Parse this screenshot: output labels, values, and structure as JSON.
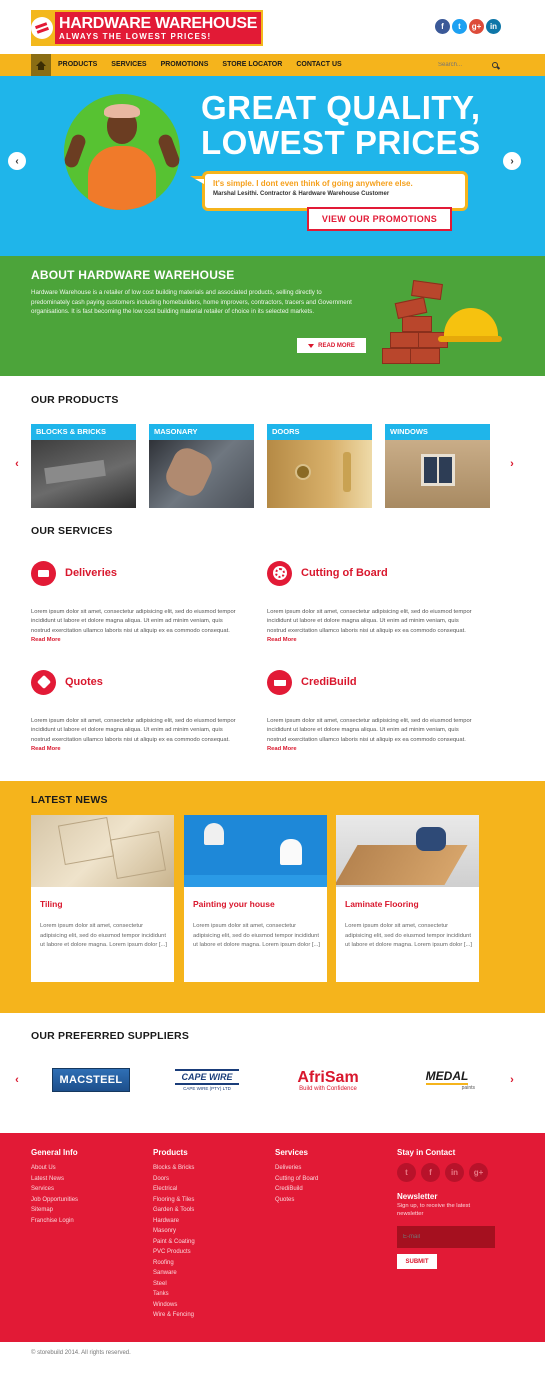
{
  "header": {
    "logo_title": "HARDWARE WAREHOUSE",
    "logo_tagline": "ALWAYS THE LOWEST PRICES!",
    "social": [
      {
        "icon": "facebook-icon",
        "glyph": "f",
        "color": "#3b5998"
      },
      {
        "icon": "twitter-icon",
        "glyph": "t",
        "color": "#1da1f2"
      },
      {
        "icon": "google-plus-icon",
        "glyph": "g+",
        "color": "#dd4b39"
      },
      {
        "icon": "linkedin-icon",
        "glyph": "in",
        "color": "#0e76a8"
      }
    ]
  },
  "nav": {
    "items": [
      "PRODUCTS",
      "SERVICES",
      "PROMOTIONS",
      "STORE LOCATOR",
      "CONTACT US"
    ],
    "search_placeholder": "Search..."
  },
  "hero": {
    "title_line1": "GREAT QUALITY,",
    "title_line2": "LOWEST PRICES",
    "quote": "It's simple. I dont even think of going anywhere else.",
    "author": "Marshal Lesithi. Contractor & Hardware Warehouse Customer",
    "cta": "VIEW OUR PROMOTIONS",
    "prev": "‹",
    "next": "›"
  },
  "about": {
    "title": "ABOUT HARDWARE WAREHOUSE",
    "text": "Hardware Warehouse is a retailer of low cost building materials and associated products, selling directly to predominately cash paying customers including homebuilders, home improvers, contractors, tracers and Government organisations. It is fast becoming the low cost building material retailer of choice in its selected markets.",
    "read_more": "READ MORE"
  },
  "products": {
    "title": "OUR PRODUCTS",
    "items": [
      "BLOCKS & BRICKS",
      "MASONARY",
      "DOORS",
      "WINDOWS"
    ],
    "prev": "‹",
    "next": "›"
  },
  "services": {
    "title": "OUR SERVICES",
    "items": [
      {
        "name": "Deliveries",
        "icon": "truck-icon",
        "text": "Lorem ipsum dolor sit amet, consectetur adipisicing elit, sed do eiusmod tempor incididunt ut labore et dolore magna aliqua. Ut enim ad minim veniam, quis nostrud exercitation ullamco laboris nisi ut aliquip ex ea commodo consequat.",
        "read_more": "Read More"
      },
      {
        "name": "Cutting of Board",
        "icon": "saw-blade-icon",
        "text": "Lorem ipsum dolor sit amet, consectetur adipisicing elit, sed do eiusmod tempor incididunt ut labore et dolore magna aliqua. Ut enim ad minim veniam, quis nostrud exercitation ullamco laboris nisi ut aliquip ex ea commodo consequat.",
        "read_more": "Read More"
      },
      {
        "name": "Quotes",
        "icon": "price-tag-icon",
        "text": "Lorem ipsum dolor sit amet, consectetur adipisicing elit, sed do eiusmod tempor incididunt ut labore et dolore magna aliqua. Ut enim ad minim veniam, quis nostrud exercitation ullamco laboris nisi ut aliquip ex ea commodo consequat.",
        "read_more": "Read More"
      },
      {
        "name": "CrediBuild",
        "icon": "credit-card-icon",
        "text": "Lorem ipsum dolor sit amet, consectetur adipisicing elit, sed do eiusmod tempor incididunt ut labore et dolore magna aliqua. Ut enim ad minim veniam, quis nostrud exercitation ullamco laboris nisi ut aliquip ex ea commodo consequat.",
        "read_more": "Read More"
      }
    ]
  },
  "news": {
    "title": "LATEST NEWS",
    "items": [
      {
        "heading": "Tiling",
        "text": "Lorem ipsum dolor sit amet, consectetur adipisicing elit, sed do eiusmod tempor incididunt ut labore et dolore magna. Lorem ipsum dolor [...]"
      },
      {
        "heading": "Painting your house",
        "text": "Lorem ipsum dolor sit amet, consectetur adipisicing elit, sed do eiusmod tempor incididunt ut labore et dolore magna. Lorem ipsum dolor [...]"
      },
      {
        "heading": "Laminate Flooring",
        "text": "Lorem ipsum dolor sit amet, consectetur adipisicing elit, sed do eiusmod tempor incididunt ut labore et dolore magna. Lorem ipsum dolor [...]"
      }
    ]
  },
  "suppliers": {
    "title": "OUR PREFERRED SUPPLIERS",
    "logos": [
      {
        "name": "MACSTEEL"
      },
      {
        "name": "CAPE WIRE",
        "sub": "CAPE WIRE (PTY) LTD"
      },
      {
        "name": "AfriSam",
        "sub": "Build with Confidence"
      },
      {
        "name": "MEDAL",
        "sub": "paints"
      }
    ],
    "prev": "‹",
    "next": "›"
  },
  "footer": {
    "general": {
      "title": "General Info",
      "links": [
        "About Us",
        "Latest News",
        "Services",
        "Job Opportunities",
        "Sitemap",
        "Franchise Login"
      ]
    },
    "products": {
      "title": "Products",
      "links": [
        "Blocks & Bricks",
        "Doors",
        "Electrical",
        "Flooring & Tiles",
        "Garden & Tools",
        "Hardware",
        "Masonry",
        "Paint & Coating",
        "PVC Products",
        "Roofing",
        "Sanware",
        "Steel",
        "Tanks",
        "Windows",
        "Wire & Fencing"
      ]
    },
    "services": {
      "title": "Services",
      "links": [
        "Deliveries",
        "Cutting of Board",
        "CrediBuild",
        "Quotes"
      ]
    },
    "contact": {
      "title": "Stay in Contact",
      "newsletter_title": "Newsletter",
      "newsletter_sub": "Sign up, to receive the latest newsletter",
      "email_placeholder": "E-mail",
      "submit": "SUBMIT"
    },
    "copyright": "© storebuild 2014. All rights reserved."
  },
  "colors": {
    "brand_red": "#e21a36",
    "brand_yellow": "#f5b41c",
    "hero_blue": "#1fb5ea",
    "about_green": "#4ca43a"
  }
}
